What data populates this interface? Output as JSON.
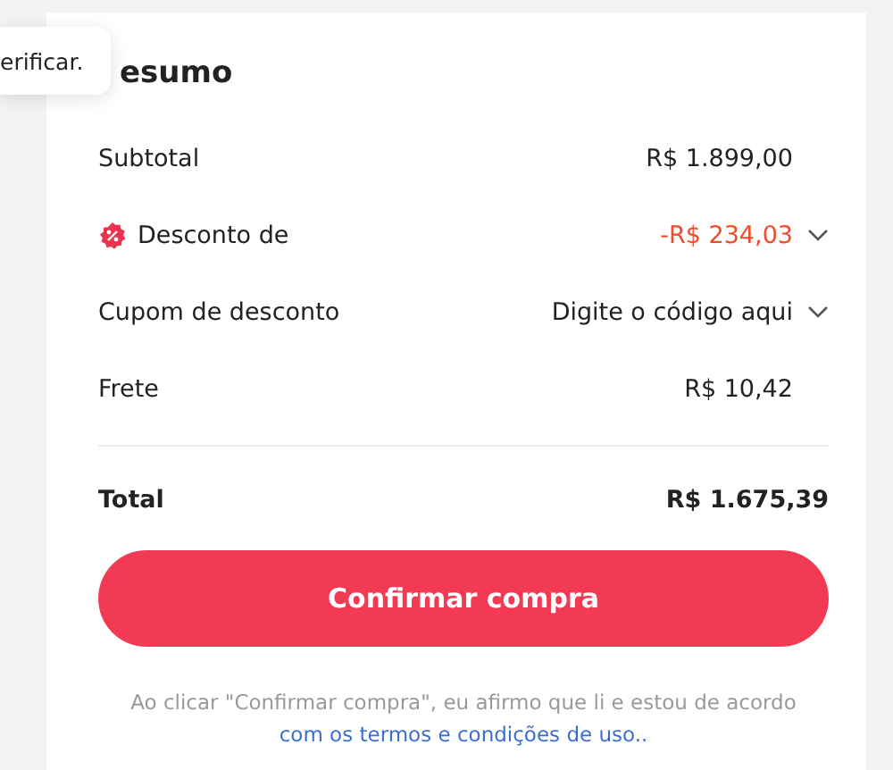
{
  "tooltip": {
    "text": "erificar."
  },
  "summary": {
    "title": "esumo",
    "rows": [
      {
        "label": "Subtotal",
        "value": "R$ 1.899,00",
        "kind": "plain",
        "dropdown": false
      },
      {
        "label": "Desconto de",
        "value": "-R$ 234,03",
        "kind": "discount",
        "dropdown": true
      },
      {
        "label": "Cupom de desconto",
        "value": "Digite o código aqui",
        "kind": "plain",
        "dropdown": true
      },
      {
        "label": "Frete",
        "value": "R$ 10,42",
        "kind": "plain",
        "dropdown": false
      }
    ],
    "total": {
      "label": "Total",
      "value": "R$ 1.675,39"
    },
    "button": "Confirmar compra",
    "note": {
      "text": "Ao clicar \"Confirmar compra\", eu afirmo que li e estou de acordo ",
      "link": "com os termos e condições de uso.."
    }
  }
}
